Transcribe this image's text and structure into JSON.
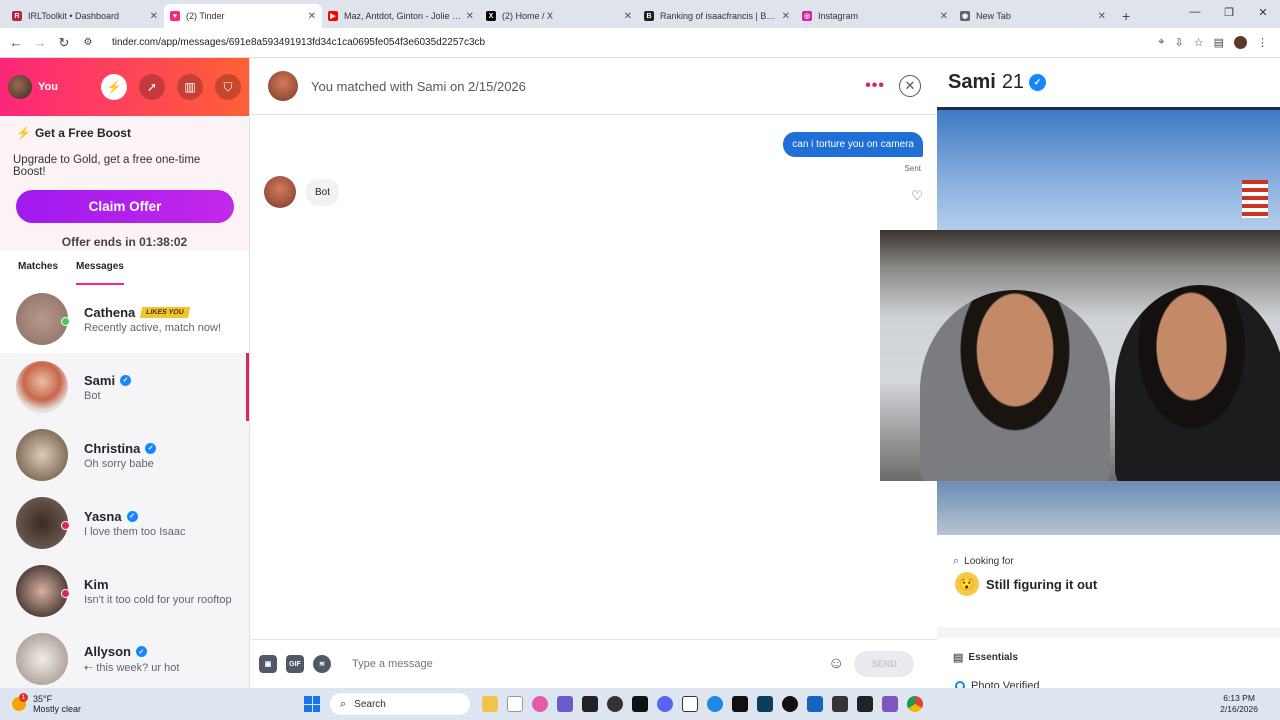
{
  "browser": {
    "tabs": [
      {
        "title": "IRLToolkit • Dashboard",
        "icon": "irltoolkit-icon",
        "color": "#c0233e"
      },
      {
        "title": "(2) Tinder",
        "icon": "tinder-icon",
        "color": "#fd267a",
        "active": true
      },
      {
        "title": "Maz, Antdot, Ginton - Jolie Fille",
        "icon": "youtube-icon",
        "color": "#ff0000"
      },
      {
        "title": "(2) Home / X",
        "icon": "x-icon",
        "color": "#000000"
      },
      {
        "title": "Ranking of isaacfrancis | BotRix",
        "icon": "botrix-icon",
        "color": "#222222"
      },
      {
        "title": "Instagram",
        "icon": "instagram-icon",
        "color": "#d6249f"
      },
      {
        "title": "New Tab",
        "icon": "chrome-icon",
        "color": "#5f6368"
      }
    ],
    "url": "tinder.com/app/messages/691e8a593491913fd34c1ca0695fe054f3e6035d2257c3cb"
  },
  "sidebar": {
    "you_label": "You",
    "boost_title": "Get a Free Boost",
    "boost_sub": "Upgrade to Gold, get a free one-time Boost!",
    "claim_label": "Claim Offer",
    "offer_ends": "Offer ends in 01:38:02",
    "tabs": [
      "Matches",
      "Messages"
    ]
  },
  "conversations": [
    {
      "name": "Cathena",
      "badge": "LIKES YOU",
      "message": "Recently active, match now!",
      "verified": false,
      "status": "#3ecf5a"
    },
    {
      "name": "Sami",
      "badge": "",
      "message": "Bot",
      "verified": true,
      "status": ""
    },
    {
      "name": "Christina",
      "badge": "",
      "message": "Oh sorry babe",
      "verified": true,
      "status": ""
    },
    {
      "name": "Yasna",
      "badge": "",
      "message": "I love them too Isaac",
      "verified": true,
      "status": "#e0245e"
    },
    {
      "name": "Kim",
      "badge": "",
      "message": "Isn't it too cold for your rooftop",
      "verified": false,
      "status": "#e0245e"
    },
    {
      "name": "Allyson",
      "badge": "",
      "message": "this week? ur hot",
      "verified": true,
      "status": ""
    }
  ],
  "chat": {
    "matched_text": "You matched with Sami on 2/15/2026",
    "outgoing": "can i torture you on camera",
    "sent_label": "Sent",
    "incoming": "Bot",
    "composer_placeholder": "Type a message",
    "gif_label": "GIF",
    "send_label": "SEND"
  },
  "profile": {
    "name": "Sami",
    "age": "21",
    "looking_for_label": "Looking for",
    "looking_for_value": "Still figuring it out",
    "essentials_label": "Essentials",
    "photo_verified": "Photo Verified"
  },
  "taskbar": {
    "temp": "35°F",
    "condition": "Mostly clear",
    "weather_badge": "1",
    "search": "Search",
    "time": "6:13 PM",
    "date": "2/16/2026"
  }
}
